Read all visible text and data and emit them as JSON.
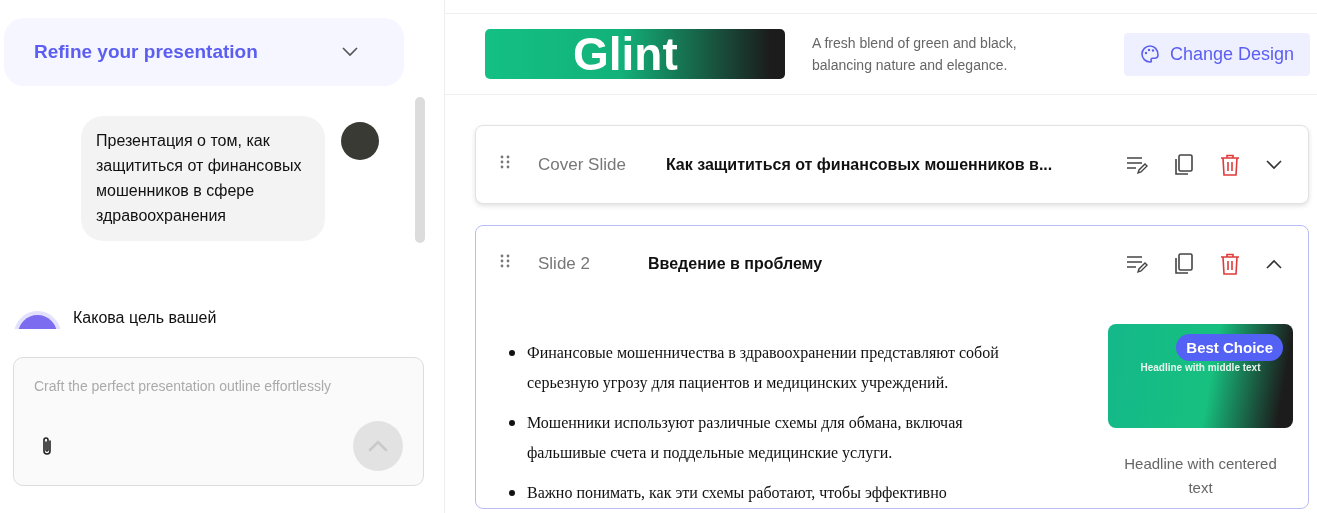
{
  "sidebar": {
    "title": "Refine your presentation",
    "messages": [
      {
        "kind": "user",
        "text": "Презентация о том, как защититься от финансовых мошенников в сфере здравоохранения"
      },
      {
        "kind": "assistant",
        "text": "Какова цель вашей"
      }
    ],
    "input": {
      "placeholder": "Craft the perfect presentation outline effortlessly"
    }
  },
  "design": {
    "name": "Glint",
    "description": "A fresh blend of green and black, balancing nature and elegance.",
    "button": "Change Design"
  },
  "slides": [
    {
      "label": "Cover Slide",
      "title": "Как защититься от финансовых мошенников в...",
      "expanded": false
    },
    {
      "label": "Slide 2",
      "title": "Введение в проблему",
      "expanded": true,
      "bullets": [
        "Финансовые мошенничества в здравоохранении представляют собой серьезную угрозу для пациентов и медицинских учреждений.",
        "Мошенники используют различные схемы для обмана, включая фальшивые счета и поддельные медицинские услуги.",
        "Важно понимать, как эти схемы работают, чтобы эффективно"
      ],
      "layout": {
        "badge": "Best Choice",
        "preview_headline": "Headline with middle text",
        "caption": "Headline with centered text"
      }
    }
  ]
}
